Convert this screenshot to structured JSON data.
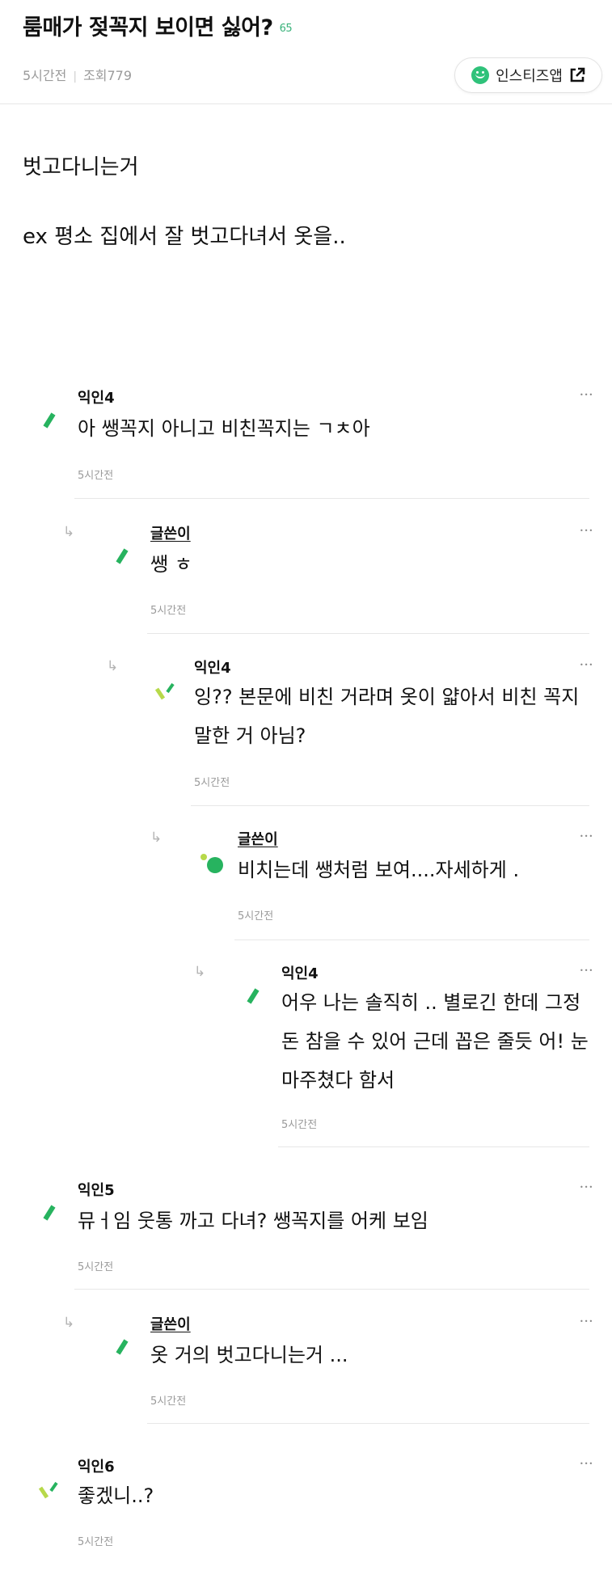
{
  "post": {
    "title": "룸매가 젖꼭지 보이면 싫어?",
    "comment_count": "65",
    "time": "5시간전",
    "views": "조회779",
    "app_link": "인스티즈앱",
    "body_line1": "벗고다니는거",
    "body_line2": "ex 평소 집에서 잘 벗고다녀서 옷을.."
  },
  "icons": {
    "app": "smile-icon",
    "external": "external-link-icon",
    "reply": "reply-arrow-icon",
    "more": "more-options-icon",
    "avatar": "avatar-icon"
  },
  "colors": {
    "accent_green": "#2fc27a",
    "avatar_green": "#27b35f",
    "avatar_lime": "#b7d94a",
    "meta_gray": "#9a9a9a"
  },
  "comments": [
    {
      "nick": "익인4",
      "text": "아 쌩꼭지 아니고 비친꼭지는 ㄱㅊ아",
      "time": "5시간전"
    },
    {
      "nick": "글쓴이",
      "text": "쌩 ㅎ",
      "time": "5시간전"
    },
    {
      "nick": "익인4",
      "text": "잉?? 본문에 비친 거라며 옷이 얇아서 비친 꼭지 말한 거 아님?",
      "time": "5시간전"
    },
    {
      "nick": "글쓴이",
      "text": "비치는데 쌩처럼 보여....자세하게 .",
      "time": "5시간전"
    },
    {
      "nick": "익인4",
      "text": "어우 나는 솔직히 .. 별로긴 한데 그정돈 참을 수 있어 근데 꼽은 줄듯 어! 눈마주쳤다 함서",
      "time": "5시간전"
    },
    {
      "nick": "익인5",
      "text": "뮤ㅓ임 웃통 까고 다녀? 쌩꼭지를 어케 보임",
      "time": "5시간전"
    },
    {
      "nick": "글쓴이",
      "text": "옷 거의 벗고다니는거 ...",
      "time": "5시간전"
    },
    {
      "nick": "익인6",
      "text": "좋겠니..?",
      "time": "5시간전"
    }
  ]
}
